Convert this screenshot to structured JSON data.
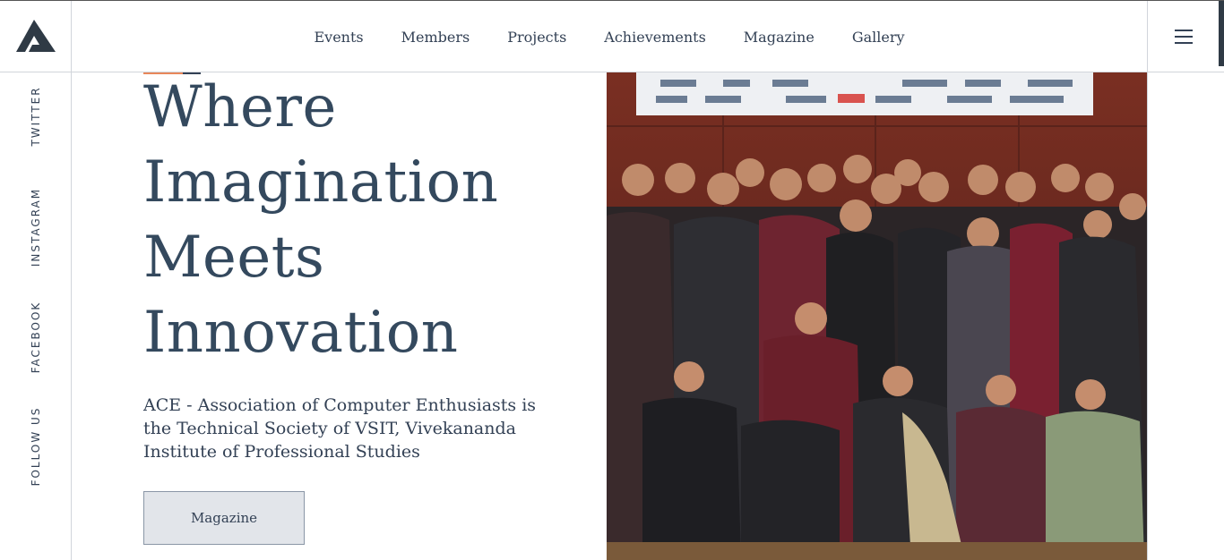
{
  "nav": {
    "items": [
      "Events",
      "Members",
      "Projects",
      "Achievements",
      "Magazine",
      "Gallery"
    ]
  },
  "social": {
    "follow_label": "FOLLOW US",
    "links": [
      "TWITTER",
      "INSTAGRAM",
      "FACEBOOK"
    ]
  },
  "hero": {
    "title_lines": [
      "Where",
      "Imagination",
      "Meets",
      "Innovation"
    ],
    "description": "ACE - Association of Computer Enthusiasts is the Technical Society of VSIT, Vivekananda Institute of Professional Studies",
    "cta_label": "Magazine"
  },
  "icons": {
    "logo": "ace-logo-icon",
    "menu": "hamburger-menu-icon"
  },
  "colors": {
    "text": "#334155",
    "accent": "#e8875b",
    "button_bg": "#e2e5ea"
  }
}
